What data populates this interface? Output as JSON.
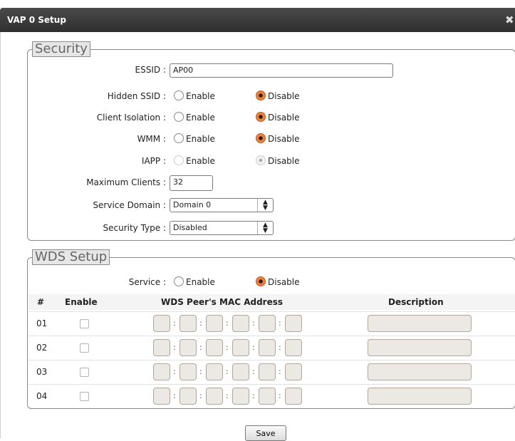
{
  "window": {
    "title": "VAP 0 Setup",
    "close_glyph": "✖"
  },
  "security": {
    "legend": "Security",
    "essid": {
      "label": "ESSID :",
      "value": "AP00"
    },
    "hidden_ssid": {
      "label": "Hidden SSID :",
      "enable": "Enable",
      "disable": "Disable",
      "selected": "Disable"
    },
    "client_isolation": {
      "label": "Client Isolation :",
      "enable": "Enable",
      "disable": "Disable",
      "selected": "Disable"
    },
    "wmm": {
      "label": "WMM :",
      "enable": "Enable",
      "disable": "Disable",
      "selected": "Disable"
    },
    "iapp": {
      "label": "IAPP :",
      "enable": "Enable",
      "disable": "Disable",
      "selected": "Disable",
      "disabled": true
    },
    "max_clients": {
      "label": "Maximum Clients :",
      "value": "32"
    },
    "service_domain": {
      "label": "Service Domain :",
      "value": "Domain 0"
    },
    "security_type": {
      "label": "Security Type :",
      "value": "Disabled"
    }
  },
  "wds": {
    "legend": "WDS Setup",
    "service": {
      "label": "Service :",
      "enable": "Enable",
      "disable": "Disable",
      "selected": "Disable"
    },
    "columns": {
      "num": "#",
      "enable": "Enable",
      "mac": "WDS Peer's MAC Address",
      "description": "Description"
    },
    "rows": [
      {
        "num": "01"
      },
      {
        "num": "02"
      },
      {
        "num": "03"
      },
      {
        "num": "04"
      }
    ]
  },
  "save_label": "Save",
  "colors": {
    "titlebar": "#3a3a3a",
    "radio_selected": "#e8843f",
    "field_disabled": "#ece8e3"
  }
}
